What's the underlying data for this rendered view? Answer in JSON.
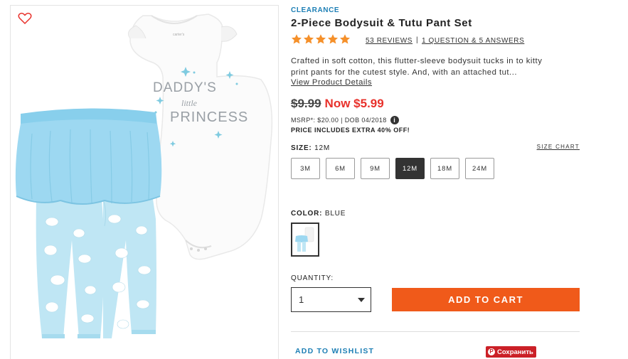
{
  "product": {
    "tag": "CLEARANCE",
    "title": "2-Piece Bodysuit & Tutu Pant Set",
    "rating": 5,
    "reviews_label": "53 REVIEWS",
    "separator": "|",
    "qa_label": "1 QUESTION & 5 ANSWERS",
    "description": "Crafted in soft cotton, this flutter-sleeve bodysuit tucks in to kitty print pants for the cutest style. And, with an attached tut...",
    "view_details": "View Product Details",
    "bodysuit_print": [
      "DADDY'S",
      "little",
      "PRINCESS"
    ]
  },
  "price": {
    "original": "$9.99",
    "current": "Now $5.99",
    "msrp": "MSRP*: $20.00 | DOB 04/2018",
    "info_icon": "info-icon",
    "promo": "PRICE INCLUDES EXTRA 40% OFF!"
  },
  "size": {
    "label": "SIZE:",
    "selected": "12M",
    "chart_link": "SIZE CHART",
    "options": [
      "3M",
      "6M",
      "9M",
      "12M",
      "18M",
      "24M"
    ]
  },
  "color": {
    "label": "COLOR:",
    "selected": "BLUE"
  },
  "quantity": {
    "label": "QUANTITY:",
    "value": "1"
  },
  "actions": {
    "add_to_cart": "ADD TO CART",
    "add_to_wishlist": "ADD TO WISHLIST",
    "pin_label": "Сохранить",
    "pin_icon": "P"
  },
  "colors": {
    "accent_blue": "#1d7fb5",
    "sale_red": "#e8312b",
    "cart_orange": "#f05a1a",
    "star_orange": "#f5902a",
    "pinterest_red": "#cb2027",
    "tutu_blue": "#8fd3ee"
  }
}
